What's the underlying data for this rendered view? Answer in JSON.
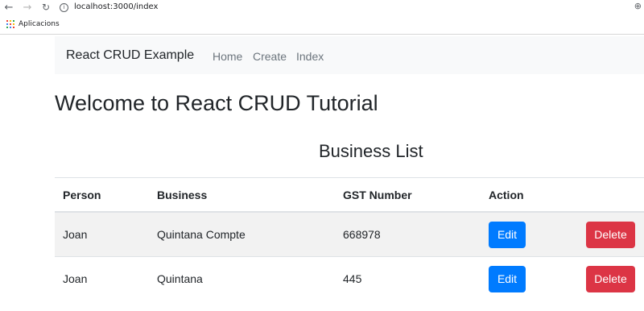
{
  "browser": {
    "url": "localhost:3000/index",
    "bookmarks": {
      "apps_label": "Aplicacions"
    }
  },
  "navbar": {
    "brand": "React CRUD Example",
    "links": [
      "Home",
      "Create",
      "Index"
    ]
  },
  "page": {
    "heading": "Welcome to React CRUD Tutorial",
    "list_title": "Business List"
  },
  "table": {
    "headers": [
      "Person",
      "Business",
      "GST Number",
      "Action"
    ],
    "rows": [
      {
        "person": "Joan",
        "business": "Quintana Compte",
        "gst": "668978",
        "edit_label": "Edit",
        "delete_label": "Delete"
      },
      {
        "person": "Joan",
        "business": "Quintana",
        "gst": "445",
        "edit_label": "Edit",
        "delete_label": "Delete"
      }
    ]
  },
  "colors": {
    "edit_button": "#007bff",
    "delete_button": "#dc3545",
    "navbar_bg": "#f8f9fa",
    "striped_row": "#f2f2f2"
  },
  "icons": [
    "back-arrow-icon",
    "forward-arrow-icon",
    "reload-icon",
    "info-icon",
    "zoom-icon",
    "apps-grid-icon"
  ]
}
